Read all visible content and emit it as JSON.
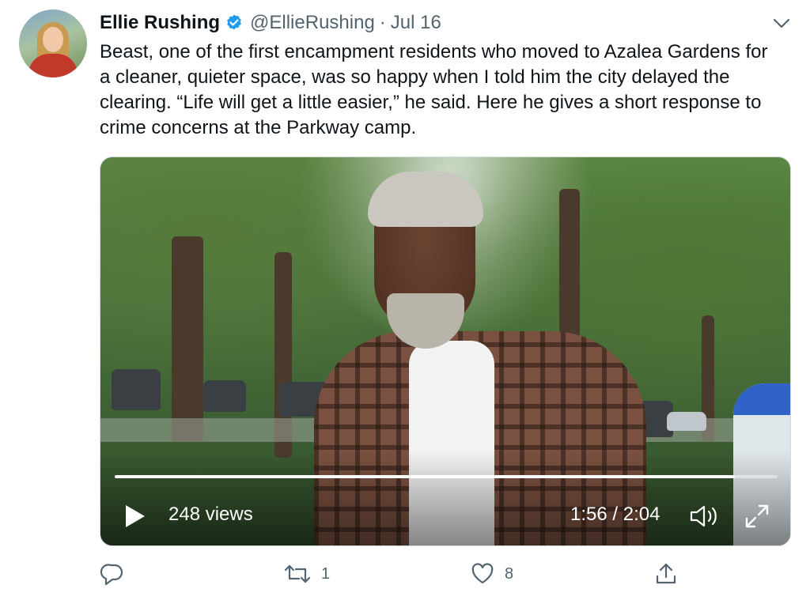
{
  "author": {
    "display_name": "Ellie Rushing",
    "handle": "@EllieRushing",
    "separator": "·",
    "date": "Jul 16"
  },
  "tweet": {
    "text": "Beast, one of the first encampment residents who moved to Azalea Gardens for a cleaner, quieter space, was so happy when I told him the city delayed the clearing. “Life will get a little easier,” he said. Here he gives a short response to crime concerns at the Parkway camp."
  },
  "video": {
    "views": "248 views",
    "time": "1:56 / 2:04",
    "progress_fraction": 0.935
  },
  "actions": {
    "reply_count": "",
    "retweet_count": "1",
    "like_count": "8"
  },
  "colors": {
    "verified": "#1d9bf0",
    "secondary_text": "#536471",
    "primary_text": "#0f1419"
  },
  "icons": {
    "verified": "verified-badge-icon",
    "menu": "chevron-down-icon",
    "play": "play-icon",
    "volume": "volume-icon",
    "fullscreen": "fullscreen-icon",
    "reply": "reply-icon",
    "retweet": "retweet-icon",
    "like": "heart-icon",
    "share": "share-icon"
  }
}
